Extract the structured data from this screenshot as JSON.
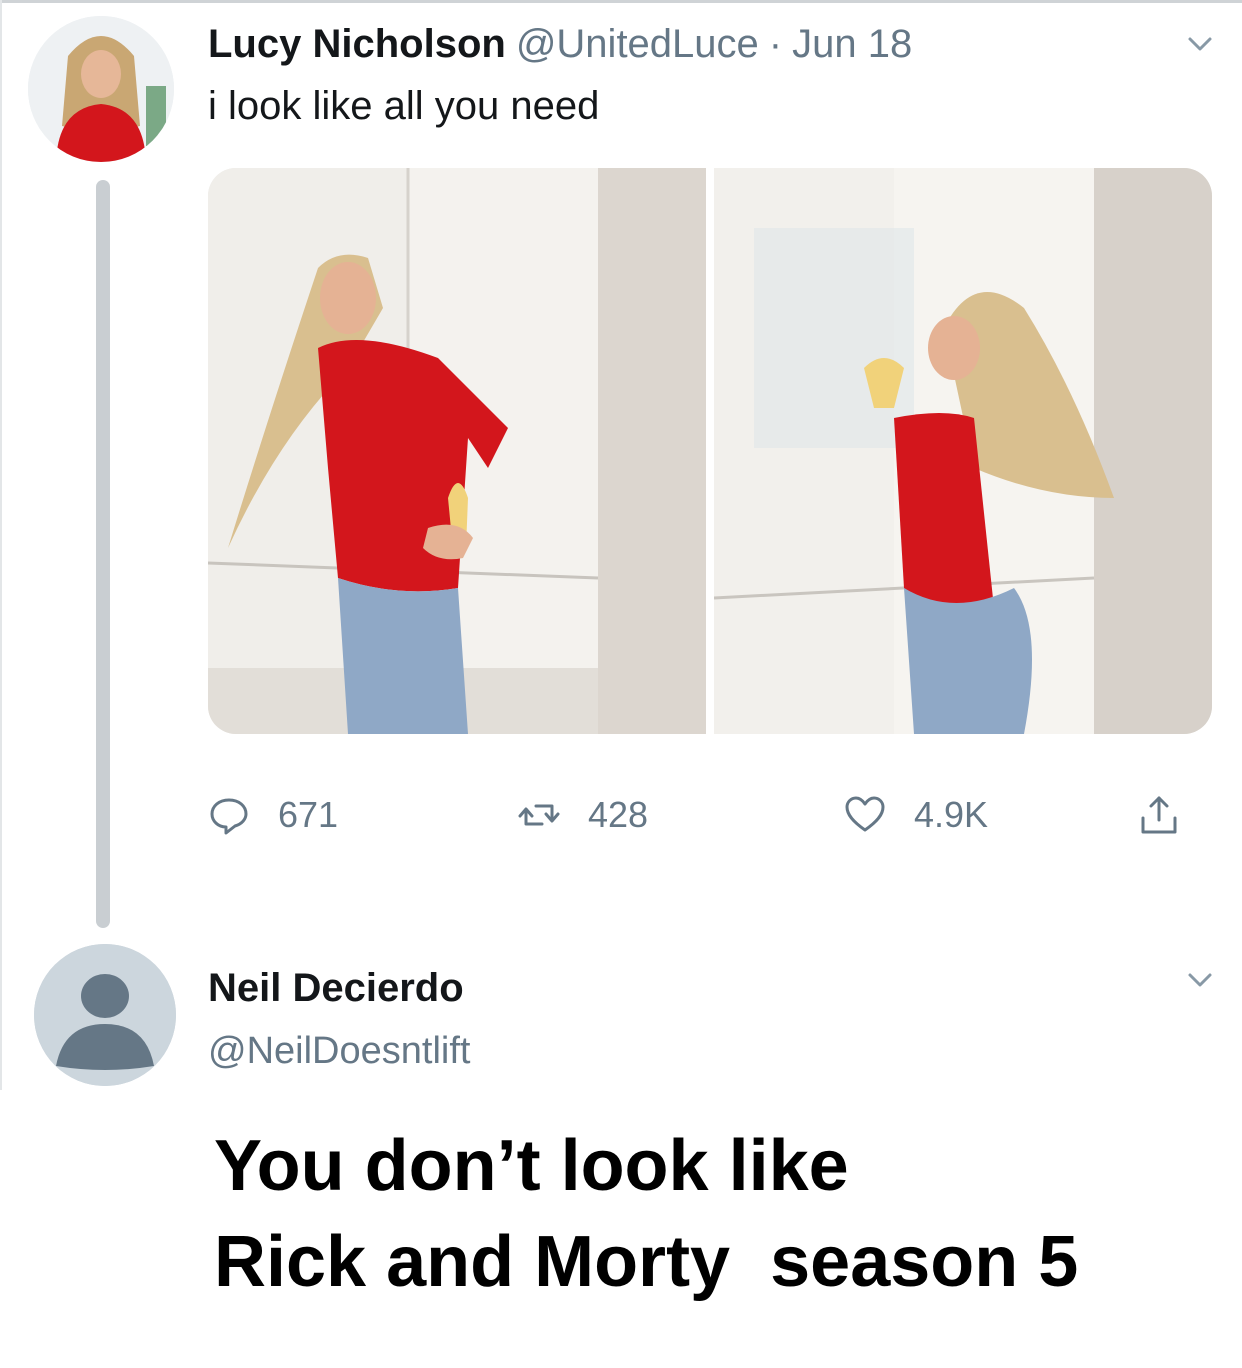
{
  "tweet": {
    "author_name": "Lucy Nicholson",
    "handle": "@UnitedLuce",
    "separator": "·",
    "date": "Jun 18",
    "text": "i look like all you need",
    "reply_count": "671",
    "retweet_count": "428",
    "like_count": "4.9K"
  },
  "reply": {
    "author_name": "Neil Decierdo",
    "handle": "@NeilDoesntlift",
    "text_line1": "You don’t look like",
    "text_line2": "Rick and Morty  season 5"
  },
  "icons": {
    "reply": "comment-bubble-icon",
    "retweet": "retweet-arrows-icon",
    "like": "heart-outline-icon",
    "share": "share-upload-icon",
    "menu": "chevron-down-icon"
  },
  "colors": {
    "text": "#14171a",
    "muted": "#657786",
    "jersey": "#d3161c",
    "thread_line": "#c9ced2"
  }
}
